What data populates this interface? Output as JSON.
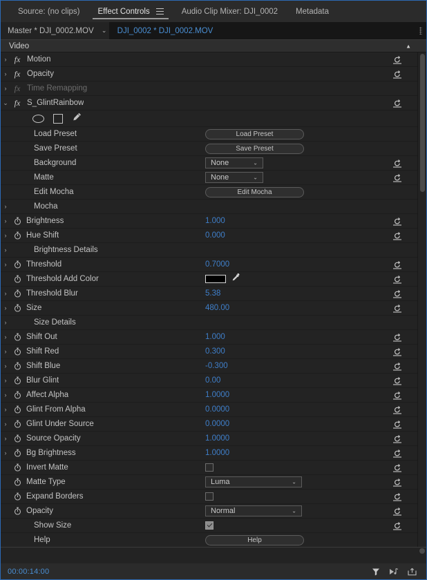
{
  "panel": {
    "tabs": [
      {
        "label": "Source: (no clips)",
        "active": false,
        "menu": false
      },
      {
        "label": "Effect Controls",
        "active": true,
        "menu": true
      },
      {
        "label": "Audio Clip Mixer: DJI_0002",
        "active": false,
        "menu": false
      },
      {
        "label": "Metadata",
        "active": false,
        "menu": false
      }
    ]
  },
  "clipbar": {
    "master": "Master * DJI_0002.MOV",
    "caret": "⌄",
    "clip": "DJI_0002 * DJI_0002.MOV"
  },
  "section": {
    "video_label": "Video",
    "collapse_caret": "▲"
  },
  "effects": [
    {
      "name": "Motion",
      "fx": true,
      "twirl": "›",
      "reset": true,
      "dim": false
    },
    {
      "name": "Opacity",
      "fx": true,
      "twirl": "›",
      "reset": true,
      "dim": false
    },
    {
      "name": "Time Remapping",
      "fx": true,
      "twirl": "›",
      "reset": false,
      "dim": true
    },
    {
      "name": "S_GlintRainbow",
      "fx": true,
      "twirl": "⌄",
      "reset": true,
      "dim": false
    }
  ],
  "mask_tools": [
    {
      "name": "ellipse-mask-tool"
    },
    {
      "name": "rectangle-mask-tool"
    },
    {
      "name": "pen-mask-tool"
    }
  ],
  "params": [
    {
      "label": "Load Preset",
      "indent": 2,
      "twirl": "",
      "stopwatch": false,
      "control": "button",
      "value": "Load Preset",
      "reset": false
    },
    {
      "label": "Save Preset",
      "indent": 2,
      "twirl": "",
      "stopwatch": false,
      "control": "button",
      "value": "Save Preset",
      "reset": false
    },
    {
      "label": "Background",
      "indent": 2,
      "twirl": "",
      "stopwatch": false,
      "control": "dropdown",
      "value": "None",
      "reset": true
    },
    {
      "label": "Matte",
      "indent": 2,
      "twirl": "",
      "stopwatch": false,
      "control": "dropdown",
      "value": "None",
      "reset": true
    },
    {
      "label": "Edit Mocha",
      "indent": 2,
      "twirl": "",
      "stopwatch": false,
      "control": "button",
      "value": "Edit Mocha",
      "reset": false
    },
    {
      "label": "Mocha",
      "indent": 2,
      "twirl": "›",
      "stopwatch": false,
      "control": "none",
      "value": "",
      "reset": false
    },
    {
      "label": "Brightness",
      "indent": 1,
      "twirl": "›",
      "stopwatch": true,
      "control": "number",
      "value": "1.000",
      "reset": true
    },
    {
      "label": "Hue Shift",
      "indent": 1,
      "twirl": "›",
      "stopwatch": true,
      "control": "number",
      "value": "0.000",
      "reset": true
    },
    {
      "label": "Brightness Details",
      "indent": 2,
      "twirl": "›",
      "stopwatch": false,
      "control": "none",
      "value": "",
      "reset": false
    },
    {
      "label": "Threshold",
      "indent": 1,
      "twirl": "›",
      "stopwatch": true,
      "control": "number",
      "value": "0.7000",
      "reset": true
    },
    {
      "label": "Threshold Add Color",
      "indent": 1,
      "twirl": "",
      "stopwatch": true,
      "control": "color",
      "value": "#000000",
      "reset": true
    },
    {
      "label": "Threshold Blur",
      "indent": 1,
      "twirl": "›",
      "stopwatch": true,
      "control": "number",
      "value": "5.38",
      "reset": true
    },
    {
      "label": "Size",
      "indent": 1,
      "twirl": "›",
      "stopwatch": true,
      "control": "number",
      "value": "480.00",
      "reset": true
    },
    {
      "label": "Size Details",
      "indent": 2,
      "twirl": "›",
      "stopwatch": false,
      "control": "none",
      "value": "",
      "reset": false
    },
    {
      "label": "Shift Out",
      "indent": 1,
      "twirl": "›",
      "stopwatch": true,
      "control": "number",
      "value": "1.000",
      "reset": true
    },
    {
      "label": "Shift Red",
      "indent": 1,
      "twirl": "›",
      "stopwatch": true,
      "control": "number",
      "value": "0.300",
      "reset": true
    },
    {
      "label": "Shift Blue",
      "indent": 1,
      "twirl": "›",
      "stopwatch": true,
      "control": "number",
      "value": "-0.300",
      "reset": true
    },
    {
      "label": "Blur Glint",
      "indent": 1,
      "twirl": "›",
      "stopwatch": true,
      "control": "number",
      "value": "0.00",
      "reset": true
    },
    {
      "label": "Affect Alpha",
      "indent": 1,
      "twirl": "›",
      "stopwatch": true,
      "control": "number",
      "value": "1.0000",
      "reset": true
    },
    {
      "label": "Glint From Alpha",
      "indent": 1,
      "twirl": "›",
      "stopwatch": true,
      "control": "number",
      "value": "0.0000",
      "reset": true
    },
    {
      "label": "Glint Under Source",
      "indent": 1,
      "twirl": "›",
      "stopwatch": true,
      "control": "number",
      "value": "0.0000",
      "reset": true
    },
    {
      "label": "Source Opacity",
      "indent": 1,
      "twirl": "›",
      "stopwatch": true,
      "control": "number",
      "value": "1.0000",
      "reset": true
    },
    {
      "label": "Bg Brightness",
      "indent": 1,
      "twirl": "›",
      "stopwatch": true,
      "control": "number",
      "value": "1.0000",
      "reset": true
    },
    {
      "label": "Invert Matte",
      "indent": 1,
      "twirl": "",
      "stopwatch": true,
      "control": "checkbox",
      "value": "unchecked",
      "reset": true
    },
    {
      "label": "Matte Type",
      "indent": 1,
      "twirl": "",
      "stopwatch": true,
      "control": "dropdown-wide",
      "value": "Luma",
      "reset": true
    },
    {
      "label": "Expand Borders",
      "indent": 1,
      "twirl": "",
      "stopwatch": true,
      "control": "checkbox",
      "value": "unchecked",
      "reset": true
    },
    {
      "label": "Opacity",
      "indent": 1,
      "twirl": "",
      "stopwatch": true,
      "control": "dropdown-wide",
      "value": "Normal",
      "reset": true
    },
    {
      "label": "Show Size",
      "indent": 2,
      "twirl": "",
      "stopwatch": false,
      "control": "checkbox",
      "value": "checked",
      "reset": true
    },
    {
      "label": "Help",
      "indent": 2,
      "twirl": "",
      "stopwatch": false,
      "control": "button",
      "value": "Help",
      "reset": false
    }
  ],
  "statusbar": {
    "timecode": "00:00:14:00",
    "icons": [
      {
        "name": "filter-funnel-icon"
      },
      {
        "name": "play-audio-icon"
      },
      {
        "name": "export-frame-icon"
      }
    ]
  },
  "colors": {
    "accent_blue": "#3f7fca",
    "panel_bg": "#232323",
    "chrome_bg": "#2b2b2b",
    "focus_border": "#2c6ab5"
  }
}
